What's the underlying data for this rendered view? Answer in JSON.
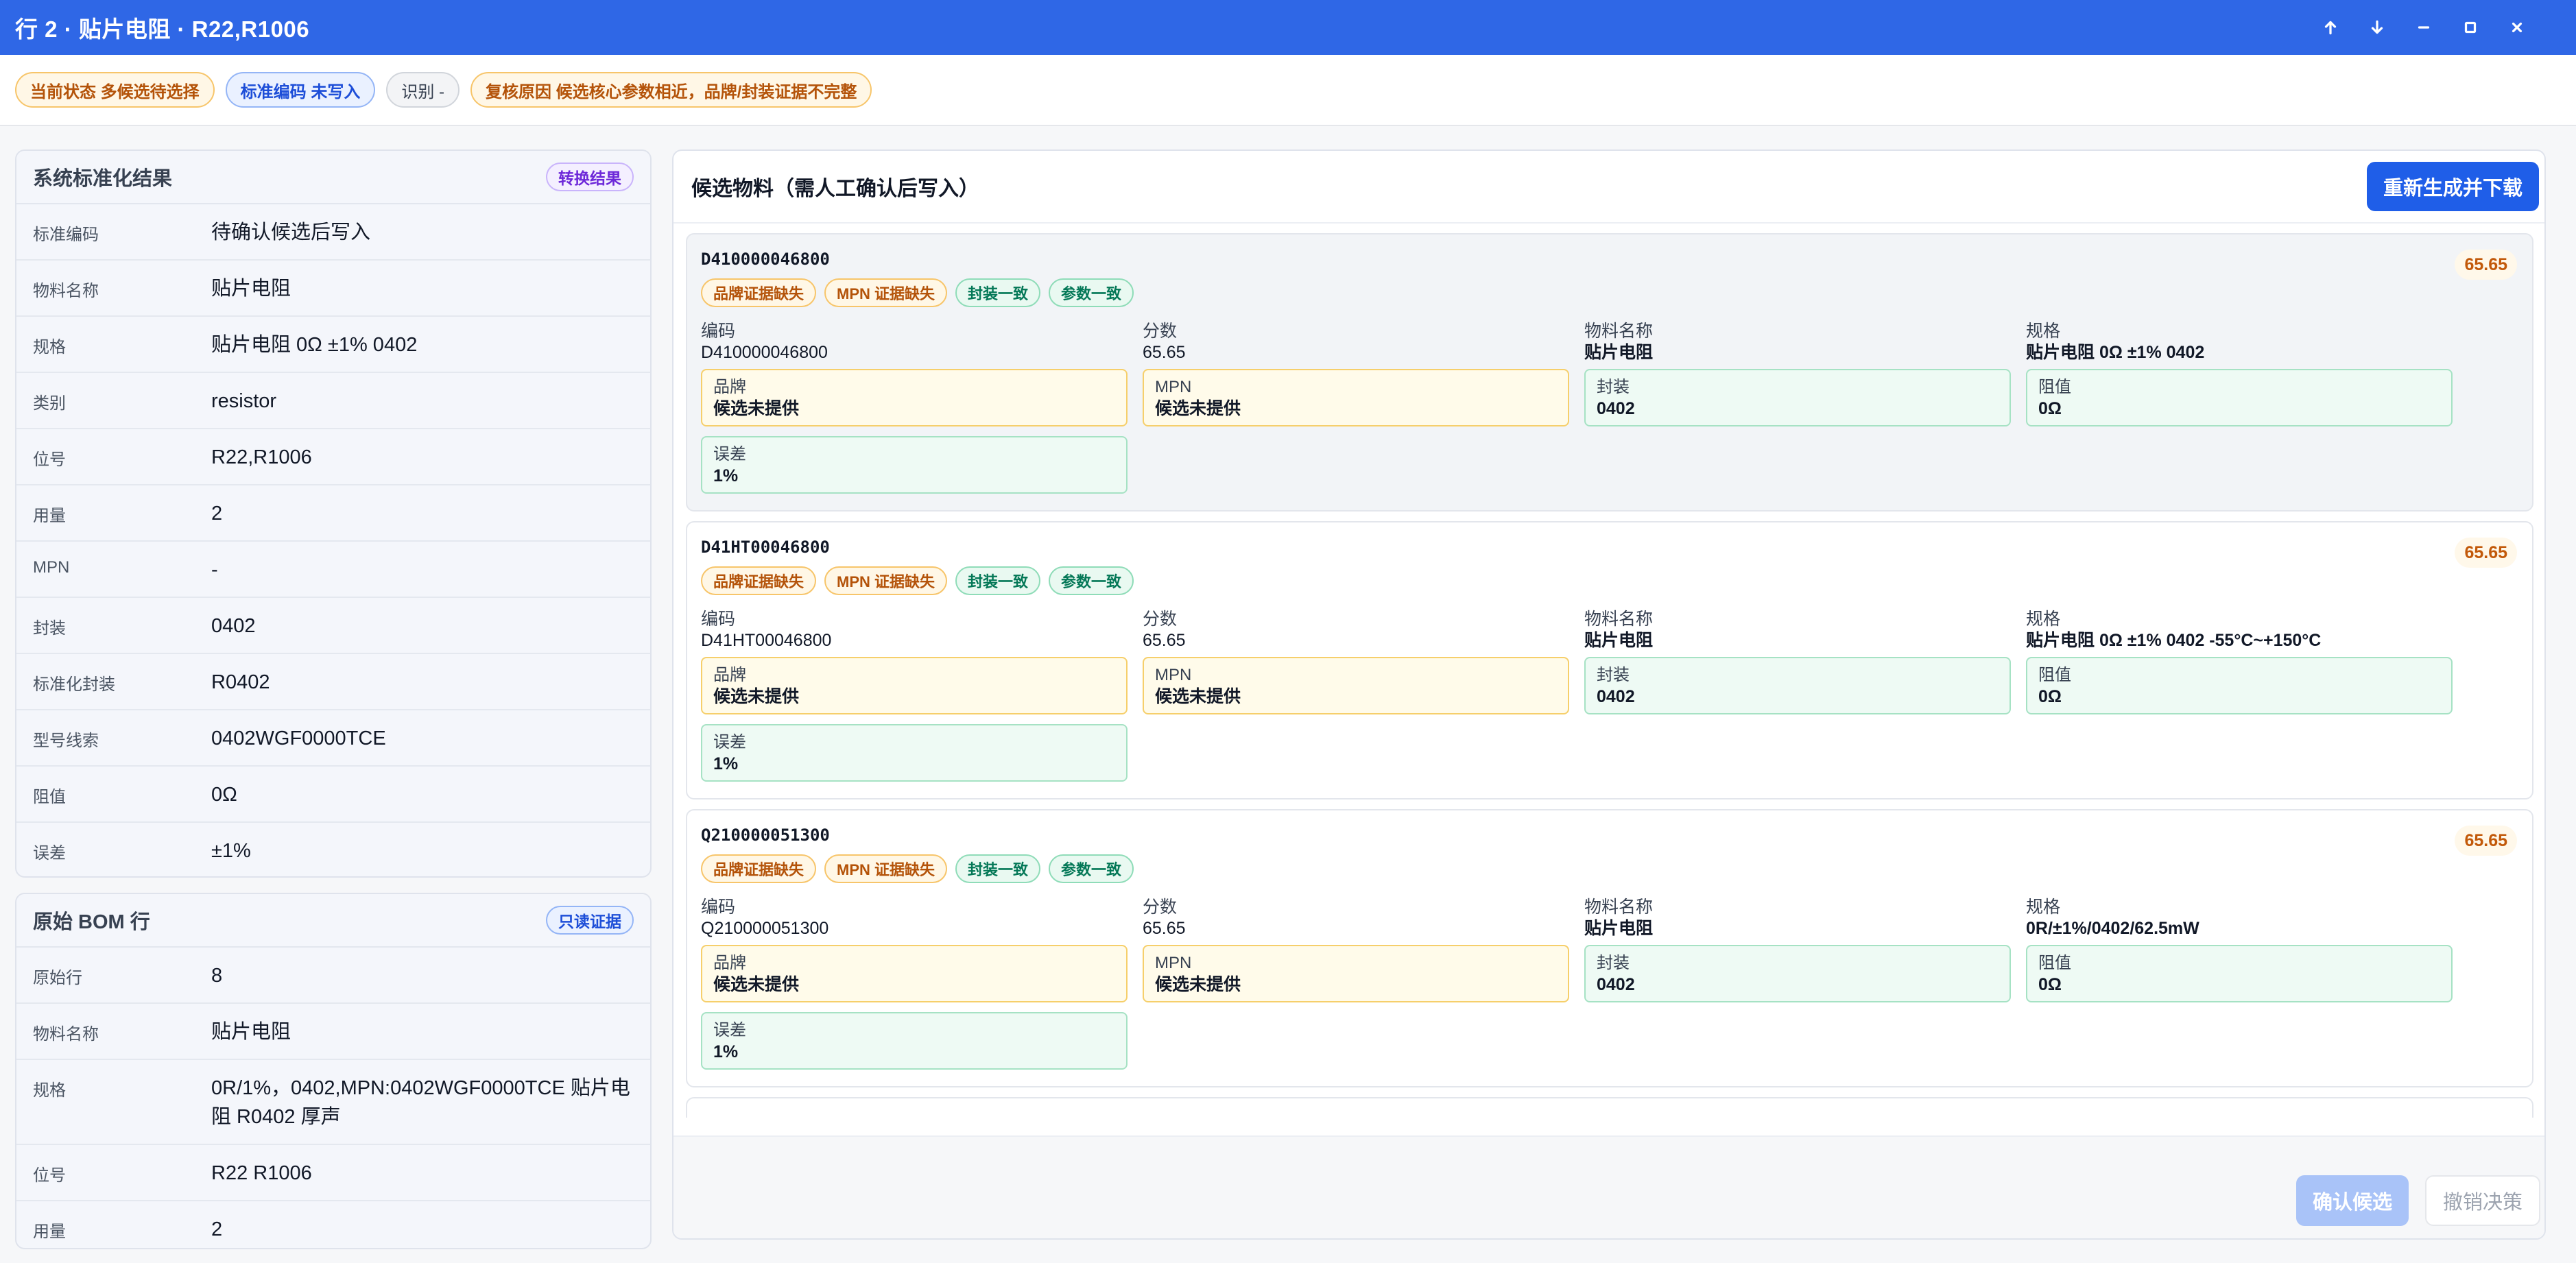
{
  "window": {
    "title": "行 2 · 贴片电阻 · R22,R1006",
    "controls": [
      "arrow-up-icon",
      "arrow-down-icon",
      "minimize-icon",
      "maximize-icon",
      "close-icon"
    ]
  },
  "status": {
    "current_state": "当前状态 多候选待选择",
    "std_code": "标准编码 未写入",
    "recognition": "识别 -",
    "review_reason": "复核原因 候选核心参数相近，品牌/封装证据不完整"
  },
  "normalized": {
    "title": "系统标准化结果",
    "action": "转换结果",
    "rows": [
      {
        "k": "标准编码",
        "v": "待确认候选后写入"
      },
      {
        "k": "物料名称",
        "v": "贴片电阻"
      },
      {
        "k": "规格",
        "v": "贴片电阻 0Ω ±1% 0402"
      },
      {
        "k": "类别",
        "v": "resistor"
      },
      {
        "k": "位号",
        "v": "R22,R1006"
      },
      {
        "k": "用量",
        "v": "2"
      },
      {
        "k": "MPN",
        "v": "-"
      },
      {
        "k": "封装",
        "v": "0402"
      },
      {
        "k": "标准化封装",
        "v": "R0402"
      },
      {
        "k": "型号线索",
        "v": "0402WGF0000TCE"
      },
      {
        "k": "阻值",
        "v": "0Ω"
      },
      {
        "k": "误差",
        "v": "±1%"
      }
    ]
  },
  "raw_bom": {
    "title": "原始 BOM 行",
    "action": "只读证据",
    "rows": [
      {
        "k": "原始行",
        "v": "8"
      },
      {
        "k": "物料名称",
        "v": "贴片电阻"
      },
      {
        "k": "规格",
        "v": "0R/1%，0402,MPN:0402WGF0000TCE 贴片电阻 R0402 厚声"
      },
      {
        "k": "位号",
        "v": "R22 R1006"
      },
      {
        "k": "用量",
        "v": "2"
      }
    ]
  },
  "candidates_panel": {
    "title": "候选物料（需人工确认后写入）",
    "regenerate_label": "重新生成并下载",
    "confirm_label": "确认候选",
    "undo_label": "撤销决策"
  },
  "candidates": [
    {
      "code": "D410000046800",
      "score": "65.65",
      "tags": [
        {
          "text": "品牌证据缺失",
          "kind": "warn"
        },
        {
          "text": "MPN 证据缺失",
          "kind": "warn"
        },
        {
          "text": "封装一致",
          "kind": "ok"
        },
        {
          "text": "参数一致",
          "kind": "ok"
        }
      ],
      "fields": [
        {
          "label": "编码",
          "value": "D410000046800",
          "bold": false
        },
        {
          "label": "分数",
          "value": "65.65",
          "bold": false
        },
        {
          "label": "物料名称",
          "value": "贴片电阻",
          "bold": true
        },
        {
          "label": "规格",
          "value": "贴片电阻 0Ω ±1% 0402",
          "bold": true
        }
      ],
      "boxes": [
        {
          "label": "品牌",
          "value": "候选未提供",
          "kind": "warn"
        },
        {
          "label": "MPN",
          "value": "候选未提供",
          "kind": "warn"
        },
        {
          "label": "封装",
          "value": "0402",
          "kind": "ok"
        },
        {
          "label": "阻值",
          "value": "0Ω",
          "kind": "ok"
        },
        {
          "label": "误差",
          "value": "1%",
          "kind": "ok"
        }
      ]
    },
    {
      "code": "D41HT00046800",
      "score": "65.65",
      "tags": [
        {
          "text": "品牌证据缺失",
          "kind": "warn"
        },
        {
          "text": "MPN 证据缺失",
          "kind": "warn"
        },
        {
          "text": "封装一致",
          "kind": "ok"
        },
        {
          "text": "参数一致",
          "kind": "ok"
        }
      ],
      "fields": [
        {
          "label": "编码",
          "value": "D41HT00046800",
          "bold": false
        },
        {
          "label": "分数",
          "value": "65.65",
          "bold": false
        },
        {
          "label": "物料名称",
          "value": "贴片电阻",
          "bold": true
        },
        {
          "label": "规格",
          "value": "贴片电阻 0Ω ±1% 0402 -55°C~+150°C",
          "bold": true
        }
      ],
      "boxes": [
        {
          "label": "品牌",
          "value": "候选未提供",
          "kind": "warn"
        },
        {
          "label": "MPN",
          "value": "候选未提供",
          "kind": "warn"
        },
        {
          "label": "封装",
          "value": "0402",
          "kind": "ok"
        },
        {
          "label": "阻值",
          "value": "0Ω",
          "kind": "ok"
        },
        {
          "label": "误差",
          "value": "1%",
          "kind": "ok"
        }
      ]
    },
    {
      "code": "Q210000051300",
      "score": "65.65",
      "tags": [
        {
          "text": "品牌证据缺失",
          "kind": "warn"
        },
        {
          "text": "MPN 证据缺失",
          "kind": "warn"
        },
        {
          "text": "封装一致",
          "kind": "ok"
        },
        {
          "text": "参数一致",
          "kind": "ok"
        }
      ],
      "fields": [
        {
          "label": "编码",
          "value": "Q210000051300",
          "bold": false
        },
        {
          "label": "分数",
          "value": "65.65",
          "bold": false
        },
        {
          "label": "物料名称",
          "value": "贴片电阻",
          "bold": true
        },
        {
          "label": "规格",
          "value": "0R/±1%/0402/62.5mW",
          "bold": true
        }
      ],
      "boxes": [
        {
          "label": "品牌",
          "value": "候选未提供",
          "kind": "warn"
        },
        {
          "label": "MPN",
          "value": "候选未提供",
          "kind": "warn"
        },
        {
          "label": "封装",
          "value": "0402",
          "kind": "ok"
        },
        {
          "label": "阻值",
          "value": "0Ω",
          "kind": "ok"
        },
        {
          "label": "误差",
          "value": "1%",
          "kind": "ok"
        }
      ]
    }
  ],
  "colors": {
    "titlebar": "#2f67e6",
    "primary": "#1f5ee8",
    "warn": "#b45309",
    "ok": "#047857"
  }
}
